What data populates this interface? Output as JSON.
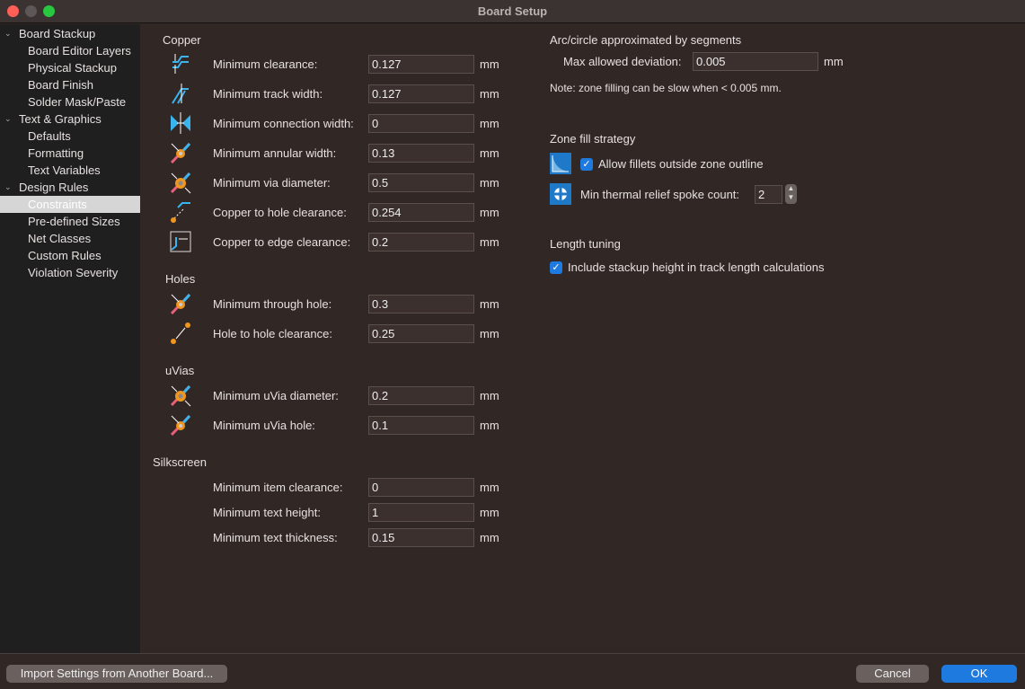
{
  "window": {
    "title": "Board Setup"
  },
  "sidebar": {
    "items": [
      {
        "label": "Board Stackup",
        "level": 0
      },
      {
        "label": "Board Editor Layers",
        "level": 1
      },
      {
        "label": "Physical Stackup",
        "level": 1
      },
      {
        "label": "Board Finish",
        "level": 1
      },
      {
        "label": "Solder Mask/Paste",
        "level": 1
      },
      {
        "label": "Text & Graphics",
        "level": 0
      },
      {
        "label": "Defaults",
        "level": 1
      },
      {
        "label": "Formatting",
        "level": 1
      },
      {
        "label": "Text Variables",
        "level": 1
      },
      {
        "label": "Design Rules",
        "level": 0
      },
      {
        "label": "Constraints",
        "level": 1,
        "selected": true
      },
      {
        "label": "Pre-defined Sizes",
        "level": 1
      },
      {
        "label": "Net Classes",
        "level": 1
      },
      {
        "label": "Custom Rules",
        "level": 1
      },
      {
        "label": "Violation Severity",
        "level": 1
      }
    ]
  },
  "sections": [
    {
      "title": "Copper",
      "rows": [
        {
          "label": "Minimum clearance:",
          "value": "0.127",
          "unit": "mm",
          "icon": "clearance-icon"
        },
        {
          "label": "Minimum track width:",
          "value": "0.127",
          "unit": "mm",
          "icon": "track-width-icon"
        },
        {
          "label": "Minimum connection width:",
          "value": "0",
          "unit": "mm",
          "icon": "connection-width-icon"
        },
        {
          "label": "Minimum annular width:",
          "value": "0.13",
          "unit": "mm",
          "icon": "annular-width-icon"
        },
        {
          "label": "Minimum via diameter:",
          "value": "0.5",
          "unit": "mm",
          "icon": "via-diameter-icon"
        },
        {
          "label": "Copper to hole clearance:",
          "value": "0.254",
          "unit": "mm",
          "icon": "hole-clearance-icon"
        },
        {
          "label": "Copper to edge clearance:",
          "value": "0.2",
          "unit": "mm",
          "icon": "edge-clearance-icon"
        }
      ]
    },
    {
      "title": "Holes",
      "rows": [
        {
          "label": "Minimum through hole:",
          "value": "0.3",
          "unit": "mm",
          "icon": "through-hole-icon"
        },
        {
          "label": "Hole to hole clearance:",
          "value": "0.25",
          "unit": "mm",
          "icon": "hole-to-hole-icon"
        }
      ]
    },
    {
      "title": "uVias",
      "rows": [
        {
          "label": "Minimum uVia diameter:",
          "value": "0.2",
          "unit": "mm",
          "icon": "uvia-diameter-icon"
        },
        {
          "label": "Minimum uVia hole:",
          "value": "0.1",
          "unit": "mm",
          "icon": "uvia-hole-icon"
        }
      ]
    },
    {
      "title": "Silkscreen",
      "rows": [
        {
          "label": "Minimum item clearance:",
          "value": "0",
          "unit": "mm"
        },
        {
          "label": "Minimum text height:",
          "value": "1",
          "unit": "mm"
        },
        {
          "label": "Minimum text thickness:",
          "value": "0.15",
          "unit": "mm"
        }
      ]
    }
  ],
  "right": {
    "arc_title": "Arc/circle approximated by segments",
    "deviation_label": "Max allowed deviation:",
    "deviation_value": "0.005",
    "deviation_unit": "mm",
    "note": "Note: zone filling can be slow when < 0.005 mm.",
    "zone_title": "Zone fill strategy",
    "fillets_label": "Allow fillets outside zone outline",
    "fillets_checked": true,
    "spoke_label": "Min thermal relief spoke count:",
    "spoke_value": "2",
    "length_title": "Length tuning",
    "stackup_label": "Include stackup height in track length calculations",
    "stackup_checked": true
  },
  "footer": {
    "import_label": "Import Settings from Another Board...",
    "cancel_label": "Cancel",
    "ok_label": "OK"
  },
  "colors": {
    "accent": "#1f7ae0",
    "close": "#ff5f57",
    "minimize": "#5d5757",
    "zoom": "#28c840"
  }
}
